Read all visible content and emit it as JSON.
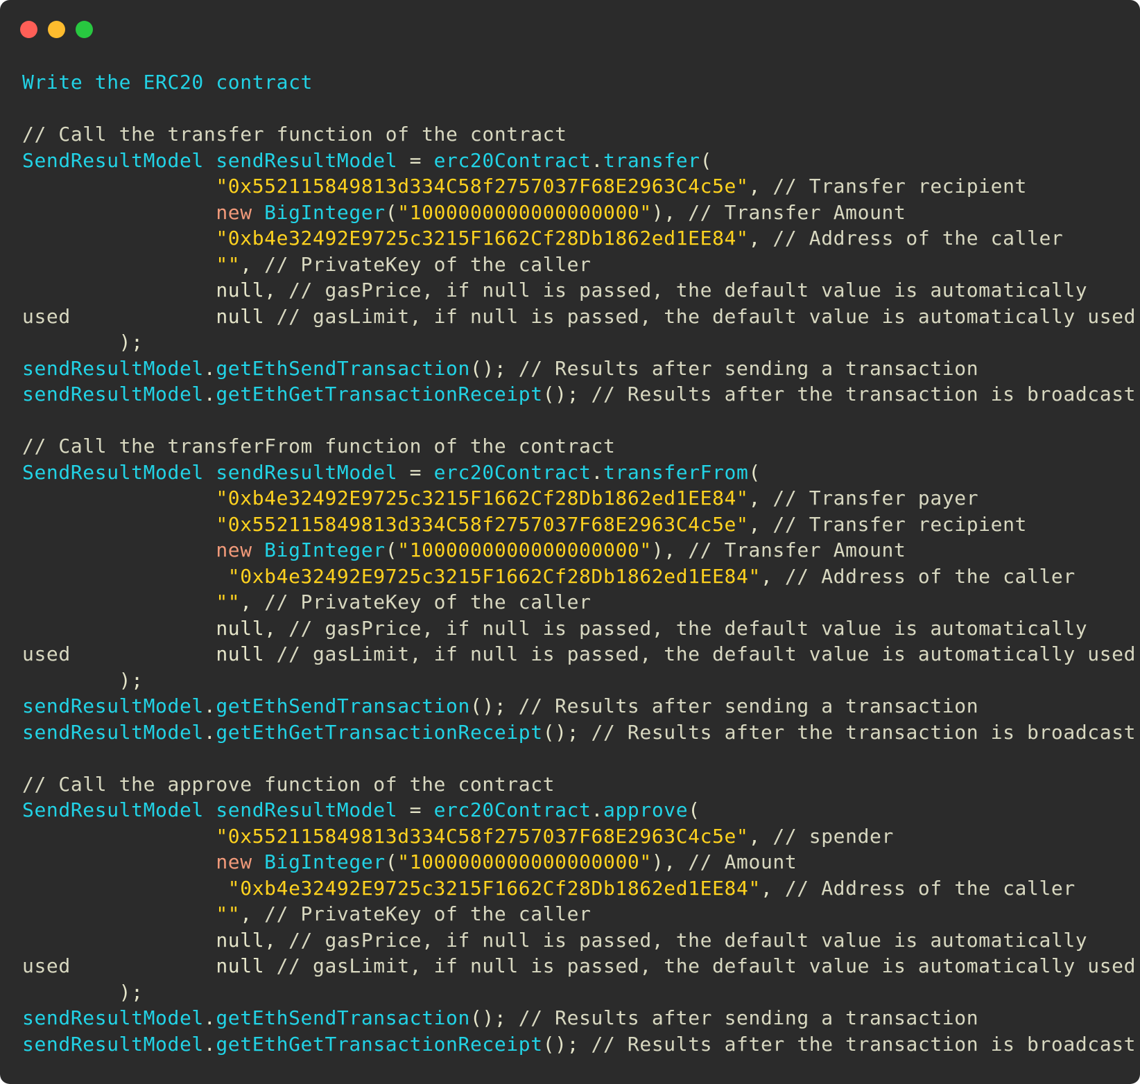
{
  "window": {
    "controls": [
      {
        "name": "close-dot",
        "color": "#ff5f57"
      },
      {
        "name": "minimize-dot",
        "color": "#febc2e"
      },
      {
        "name": "maximize-dot",
        "color": "#28c840"
      }
    ]
  },
  "colors": {
    "background": "#2b2b2b",
    "plain": "#e4e4c8",
    "ident": "#22d3e6",
    "string": "#ffd21f",
    "keyword": "#f29a7a",
    "comment": "#d8d8c0"
  },
  "code_lines": [
    [
      {
        "t": "ident",
        "v": "Write the ERC20 contract"
      }
    ],
    [],
    [
      {
        "t": "comment",
        "v": "// Call the transfer function of the contract"
      }
    ],
    [
      {
        "t": "ident",
        "v": "SendResultModel sendResultModel"
      },
      {
        "t": "plain",
        "v": " = "
      },
      {
        "t": "ident",
        "v": "erc20Contract"
      },
      {
        "t": "plain",
        "v": "."
      },
      {
        "t": "ident",
        "v": "transfer"
      },
      {
        "t": "plain",
        "v": "("
      }
    ],
    [
      {
        "t": "plain",
        "v": "                "
      },
      {
        "t": "string",
        "v": "\"0x552115849813d334C58f2757037F68E2963C4c5e\""
      },
      {
        "t": "plain",
        "v": ", "
      },
      {
        "t": "comment",
        "v": "// Transfer recipient"
      }
    ],
    [
      {
        "t": "plain",
        "v": "                "
      },
      {
        "t": "keyword",
        "v": "new "
      },
      {
        "t": "ident",
        "v": "BigInteger"
      },
      {
        "t": "plain",
        "v": "("
      },
      {
        "t": "string",
        "v": "\"1000000000000000000\""
      },
      {
        "t": "plain",
        "v": "), "
      },
      {
        "t": "comment",
        "v": "// Transfer Amount"
      }
    ],
    [
      {
        "t": "plain",
        "v": "                "
      },
      {
        "t": "string",
        "v": "\"0xb4e32492E9725c3215F1662Cf28Db1862ed1EE84\""
      },
      {
        "t": "plain",
        "v": ", "
      },
      {
        "t": "comment",
        "v": "// Address of the caller"
      }
    ],
    [
      {
        "t": "plain",
        "v": "                "
      },
      {
        "t": "string",
        "v": "\"\""
      },
      {
        "t": "plain",
        "v": ", "
      },
      {
        "t": "comment",
        "v": "// PrivateKey of the caller"
      }
    ],
    [
      {
        "t": "plain",
        "v": "                null, "
      },
      {
        "t": "comment",
        "v": "// gasPrice, if null is passed, the default value is automatically"
      }
    ],
    [
      {
        "t": "comment",
        "v": "used"
      },
      {
        "t": "plain",
        "v": "            null "
      },
      {
        "t": "comment",
        "v": "// gasLimit, if null is passed, the default value is automatically used"
      }
    ],
    [
      {
        "t": "plain",
        "v": "        );"
      }
    ],
    [
      {
        "t": "ident",
        "v": "sendResultModel"
      },
      {
        "t": "plain",
        "v": "."
      },
      {
        "t": "ident",
        "v": "getEthSendTransaction"
      },
      {
        "t": "plain",
        "v": "(); "
      },
      {
        "t": "comment",
        "v": "// Results after sending a transaction"
      }
    ],
    [
      {
        "t": "ident",
        "v": "sendResultModel"
      },
      {
        "t": "plain",
        "v": "."
      },
      {
        "t": "ident",
        "v": "getEthGetTransactionReceipt"
      },
      {
        "t": "plain",
        "v": "(); "
      },
      {
        "t": "comment",
        "v": "// Results after the transaction is broadcast"
      }
    ],
    [],
    [
      {
        "t": "comment",
        "v": "// Call the transferFrom function of the contract"
      }
    ],
    [
      {
        "t": "ident",
        "v": "SendResultModel sendResultModel"
      },
      {
        "t": "plain",
        "v": " = "
      },
      {
        "t": "ident",
        "v": "erc20Contract"
      },
      {
        "t": "plain",
        "v": "."
      },
      {
        "t": "ident",
        "v": "transferFrom"
      },
      {
        "t": "plain",
        "v": "("
      }
    ],
    [
      {
        "t": "plain",
        "v": "                "
      },
      {
        "t": "string",
        "v": "\"0xb4e32492E9725c3215F1662Cf28Db1862ed1EE84\""
      },
      {
        "t": "plain",
        "v": ", "
      },
      {
        "t": "comment",
        "v": "// Transfer payer"
      }
    ],
    [
      {
        "t": "plain",
        "v": "                "
      },
      {
        "t": "string",
        "v": "\"0x552115849813d334C58f2757037F68E2963C4c5e\""
      },
      {
        "t": "plain",
        "v": ", "
      },
      {
        "t": "comment",
        "v": "// Transfer recipient"
      }
    ],
    [
      {
        "t": "plain",
        "v": "                "
      },
      {
        "t": "keyword",
        "v": "new "
      },
      {
        "t": "ident",
        "v": "BigInteger"
      },
      {
        "t": "plain",
        "v": "("
      },
      {
        "t": "string",
        "v": "\"1000000000000000000\""
      },
      {
        "t": "plain",
        "v": "), "
      },
      {
        "t": "comment",
        "v": "// Transfer Amount"
      }
    ],
    [
      {
        "t": "plain",
        "v": "                 "
      },
      {
        "t": "string",
        "v": "\"0xb4e32492E9725c3215F1662Cf28Db1862ed1EE84\""
      },
      {
        "t": "plain",
        "v": ", "
      },
      {
        "t": "comment",
        "v": "// Address of the caller"
      }
    ],
    [
      {
        "t": "plain",
        "v": "                "
      },
      {
        "t": "string",
        "v": "\"\""
      },
      {
        "t": "plain",
        "v": ", "
      },
      {
        "t": "comment",
        "v": "// PrivateKey of the caller"
      }
    ],
    [
      {
        "t": "plain",
        "v": "                null, "
      },
      {
        "t": "comment",
        "v": "// gasPrice, if null is passed, the default value is automatically"
      }
    ],
    [
      {
        "t": "comment",
        "v": "used"
      },
      {
        "t": "plain",
        "v": "            null "
      },
      {
        "t": "comment",
        "v": "// gasLimit, if null is passed, the default value is automatically used"
      }
    ],
    [
      {
        "t": "plain",
        "v": "        );"
      }
    ],
    [
      {
        "t": "ident",
        "v": "sendResultModel"
      },
      {
        "t": "plain",
        "v": "."
      },
      {
        "t": "ident",
        "v": "getEthSendTransaction"
      },
      {
        "t": "plain",
        "v": "(); "
      },
      {
        "t": "comment",
        "v": "// Results after sending a transaction"
      }
    ],
    [
      {
        "t": "ident",
        "v": "sendResultModel"
      },
      {
        "t": "plain",
        "v": "."
      },
      {
        "t": "ident",
        "v": "getEthGetTransactionReceipt"
      },
      {
        "t": "plain",
        "v": "(); "
      },
      {
        "t": "comment",
        "v": "// Results after the transaction is broadcast"
      }
    ],
    [],
    [
      {
        "t": "comment",
        "v": "// Call the approve function of the contract"
      }
    ],
    [
      {
        "t": "ident",
        "v": "SendResultModel sendResultModel"
      },
      {
        "t": "plain",
        "v": " = "
      },
      {
        "t": "ident",
        "v": "erc20Contract"
      },
      {
        "t": "plain",
        "v": "."
      },
      {
        "t": "ident",
        "v": "approve"
      },
      {
        "t": "plain",
        "v": "("
      }
    ],
    [
      {
        "t": "plain",
        "v": "                "
      },
      {
        "t": "string",
        "v": "\"0x552115849813d334C58f2757037F68E2963C4c5e\""
      },
      {
        "t": "plain",
        "v": ", "
      },
      {
        "t": "comment",
        "v": "// spender"
      }
    ],
    [
      {
        "t": "plain",
        "v": "                "
      },
      {
        "t": "keyword",
        "v": "new "
      },
      {
        "t": "ident",
        "v": "BigInteger"
      },
      {
        "t": "plain",
        "v": "("
      },
      {
        "t": "string",
        "v": "\"1000000000000000000\""
      },
      {
        "t": "plain",
        "v": "), "
      },
      {
        "t": "comment",
        "v": "// Amount"
      }
    ],
    [
      {
        "t": "plain",
        "v": "                 "
      },
      {
        "t": "string",
        "v": "\"0xb4e32492E9725c3215F1662Cf28Db1862ed1EE84\""
      },
      {
        "t": "plain",
        "v": ", "
      },
      {
        "t": "comment",
        "v": "// Address of the caller"
      }
    ],
    [
      {
        "t": "plain",
        "v": "                "
      },
      {
        "t": "string",
        "v": "\"\""
      },
      {
        "t": "plain",
        "v": ", "
      },
      {
        "t": "comment",
        "v": "// PrivateKey of the caller"
      }
    ],
    [
      {
        "t": "plain",
        "v": "                null, "
      },
      {
        "t": "comment",
        "v": "// gasPrice, if null is passed, the default value is automatically"
      }
    ],
    [
      {
        "t": "comment",
        "v": "used"
      },
      {
        "t": "plain",
        "v": "            null "
      },
      {
        "t": "comment",
        "v": "// gasLimit, if null is passed, the default value is automatically used"
      }
    ],
    [
      {
        "t": "plain",
        "v": "        );"
      }
    ],
    [
      {
        "t": "ident",
        "v": "sendResultModel"
      },
      {
        "t": "plain",
        "v": "."
      },
      {
        "t": "ident",
        "v": "getEthSendTransaction"
      },
      {
        "t": "plain",
        "v": "(); "
      },
      {
        "t": "comment",
        "v": "// Results after sending a transaction"
      }
    ],
    [
      {
        "t": "ident",
        "v": "sendResultModel"
      },
      {
        "t": "plain",
        "v": "."
      },
      {
        "t": "ident",
        "v": "getEthGetTransactionReceipt"
      },
      {
        "t": "plain",
        "v": "(); "
      },
      {
        "t": "comment",
        "v": "// Results after the transaction is broadcast"
      }
    ]
  ]
}
